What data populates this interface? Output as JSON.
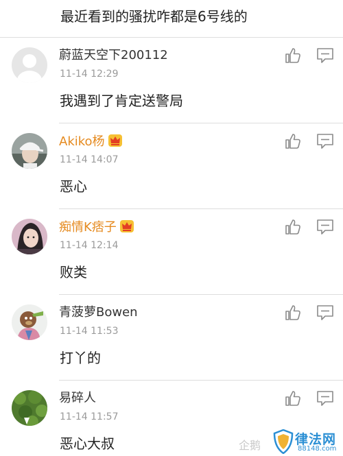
{
  "top_fragment": "最近看到的骚扰咋都是6号线的",
  "comments": [
    {
      "username": "蔚蓝天空下200112",
      "vip": false,
      "timestamp": "11-14 12:29",
      "text": "我遇到了肯定送警局",
      "avatar": "default-avatar"
    },
    {
      "username": "Akiko杨",
      "vip": true,
      "timestamp": "11-14 14:07",
      "text": "恶心",
      "avatar": "person-white-cap-avatar"
    },
    {
      "username": "痴情K痞子",
      "vip": true,
      "timestamp": "11-14 12:14",
      "text": "败类",
      "avatar": "person-portrait-avatar"
    },
    {
      "username": "青菠萝Bowen",
      "vip": false,
      "timestamp": "11-14 11:53",
      "text": "打丫的",
      "avatar": "cartoon-character-avatar"
    },
    {
      "username": "易碎人",
      "vip": false,
      "timestamp": "11-14 11:57",
      "text": "恶心大叔",
      "avatar": "green-foliage-avatar"
    }
  ],
  "icons": {
    "like": "thumbs-up-icon",
    "reply": "comment-bubble-icon",
    "vip": "crown-icon"
  },
  "colors": {
    "vip_username": "#e58a1f",
    "plain_username": "#333333",
    "timestamp": "#9a9a9a",
    "icon": "#8a8a8a",
    "divider": "#dddddd",
    "watermark": "#2b8fd4"
  },
  "watermark": {
    "prefix": "企鹅",
    "name": "律法网",
    "url": "88148.com"
  }
}
